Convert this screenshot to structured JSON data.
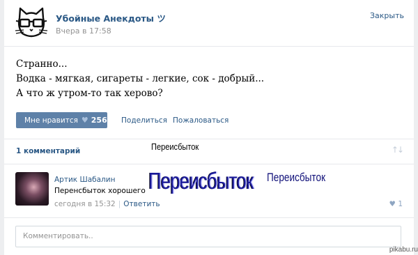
{
  "post": {
    "group_name": "Убойные Анекдоты ツ",
    "time": "Вчера в 17:58",
    "close_label": "Закрыть",
    "text_lines": [
      "Странно...",
      "Водка - мягкая, сигареты - легкие, сок - добрый...",
      "А что ж утром-то так херово?"
    ],
    "like_label": "Мне нравится",
    "like_count": "256",
    "share_label": "Поделиться",
    "report_label": "Пожаловаться"
  },
  "comments": {
    "count_label": "1 комментарий",
    "items": [
      {
        "author": "Артик Шабалин",
        "text": "Перенсбыток хорошего",
        "time": "сегодня в 15:32",
        "reply_label": "Ответить",
        "likes": "1"
      }
    ],
    "input_placeholder": "Комментировать.."
  },
  "overlay": {
    "small": "Переисбыток",
    "large": "Переисбыток",
    "medium": "Переисбыток"
  },
  "watermark": "pikabu.ru",
  "colors": {
    "link": "#2a5885",
    "like_button": "#5e81a8",
    "page_bg": "#edeef0"
  },
  "icons": {
    "group_avatar": "cat-with-glasses",
    "like": "heart",
    "sort": "up-down-arrows"
  }
}
